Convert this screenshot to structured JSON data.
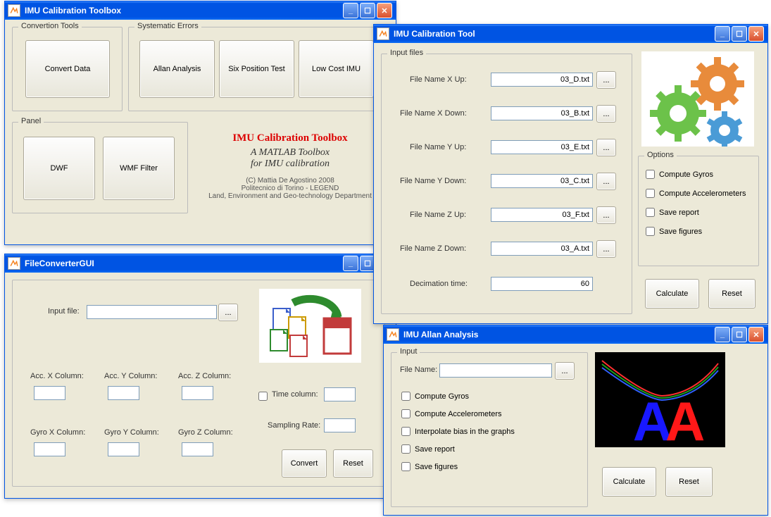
{
  "toolbox": {
    "title": "IMU Calibration Toolbox",
    "conv_group": "Convertion Tools",
    "err_group": "Systematic Errors",
    "panel_group": "Panel",
    "convert_btn": "Convert Data",
    "allan_btn": "Allan Analysis",
    "sixpos_btn": "Six Position Test",
    "lowcost_btn": "Low Cost IMU",
    "dwf_btn": "DWF",
    "wmf_btn": "WMF Filter",
    "main_title": "IMU Calibration Toolbox",
    "subtitle1": "A MATLAB Toolbox",
    "subtitle2": "for IMU calibration",
    "credit1": "(C) Mattia De Agostino 2008",
    "credit2": "Politecnico di Torino - LEGEND",
    "credit3": "Land, Environment and Geo-technology Department"
  },
  "fileconv": {
    "title": "FileConverterGUI",
    "input_label": "Input file:",
    "input_value": "",
    "browse": "...",
    "accx": "Acc. X Column:",
    "accy": "Acc. Y Column:",
    "accz": "Acc. Z Column:",
    "gyrox": "Gyro X Column:",
    "gyroy": "Gyro Y Column:",
    "gyroz": "Gyro Z Column:",
    "timecol": "Time column:",
    "sampling": "Sampling Rate:",
    "convert": "Convert",
    "reset": "Reset",
    "accx_val": "",
    "accy_val": "",
    "accz_val": "",
    "gyrox_val": "",
    "gyroy_val": "",
    "gyroz_val": "",
    "timecol_val": "",
    "sampling_val": ""
  },
  "caltool": {
    "title": "IMU Calibration Tool",
    "input_group": "Input files",
    "options_group": "Options",
    "labels": {
      "xup": "File Name X Up:",
      "xdown": "File Name X Down:",
      "yup": "File Name Y Up:",
      "ydown": "File Name Y Down:",
      "zup": "File Name Z Up:",
      "zdown": "File Name Z Down:",
      "decim": "Decimation time:"
    },
    "values": {
      "xup": "03_D.txt",
      "xdown": "03_B.txt",
      "yup": "03_E.txt",
      "ydown": "03_C.txt",
      "zup": "03_F.txt",
      "zdown": "03_A.txt",
      "decim": "60"
    },
    "browse": "...",
    "options": {
      "gyros": "Compute Gyros",
      "accel": "Compute Accelerometers",
      "report": "Save report",
      "figures": "Save figures"
    },
    "calc": "Calculate",
    "reset": "Reset"
  },
  "allan": {
    "title": "IMU Allan Analysis",
    "input_group": "Input",
    "file_label": "File Name:",
    "file_value": "",
    "browse": "...",
    "cb": {
      "gyros": "Compute Gyros",
      "accel": "Compute Accelerometers",
      "interp": "Interpolate bias in the graphs",
      "report": "Save report",
      "figures": "Save figures"
    },
    "calc": "Calculate",
    "reset": "Reset"
  }
}
